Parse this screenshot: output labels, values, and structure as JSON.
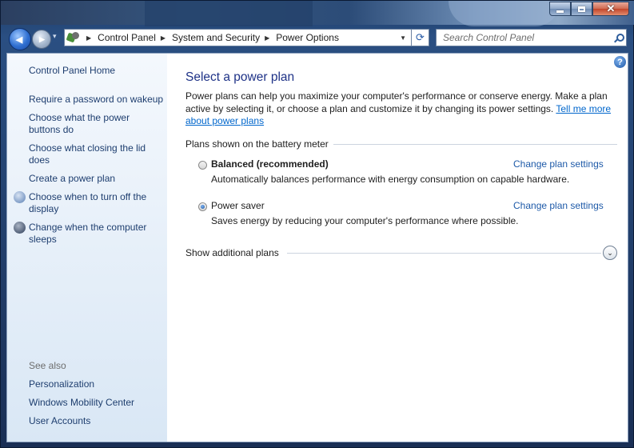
{
  "window": {
    "minimize_glyph": "–",
    "maximize_glyph": "□",
    "close_glyph": "✕"
  },
  "nav": {
    "back_glyph": "◀",
    "forward_glyph": "▶",
    "dropdown_glyph": "▾",
    "breadcrumbs": [
      "Control Panel",
      "System and Security",
      "Power Options"
    ],
    "crumb_separator": "▶",
    "address_dropdown_glyph": "▼",
    "refresh_glyph": "⟳",
    "search_placeholder": "Search Control Panel"
  },
  "sidebar": {
    "home": "Control Panel Home",
    "links": [
      "Require a password on wakeup",
      "Choose what the power buttons do",
      "Choose what closing the lid does",
      "Create a power plan",
      "Choose when to turn off the display",
      "Change when the computer sleeps"
    ],
    "see_also_label": "See also",
    "see_also_links": [
      "Personalization",
      "Windows Mobility Center",
      "User Accounts"
    ]
  },
  "main": {
    "title": "Select a power plan",
    "intro": "Power plans can help you maximize your computer's performance or conserve energy. Make a plan active by selecting it, or choose a plan and customize it by changing its power settings.",
    "intro_link": "Tell me more about power plans",
    "group_label": "Plans shown on the battery meter",
    "plans": [
      {
        "name": "Balanced (recommended)",
        "description": "Automatically balances performance with energy consumption on capable hardware.",
        "link": "Change plan settings",
        "selected": false
      },
      {
        "name": "Power saver",
        "description": "Saves energy by reducing your computer's performance where possible.",
        "link": "Change plan settings",
        "selected": true
      }
    ],
    "show_additional": "Show additional plans",
    "expand_glyph": "⌄"
  },
  "help_glyph": "?",
  "colors": {
    "title": "#1e3287",
    "link": "#1e5aa8",
    "sidebar_link": "#1e3e6f"
  }
}
